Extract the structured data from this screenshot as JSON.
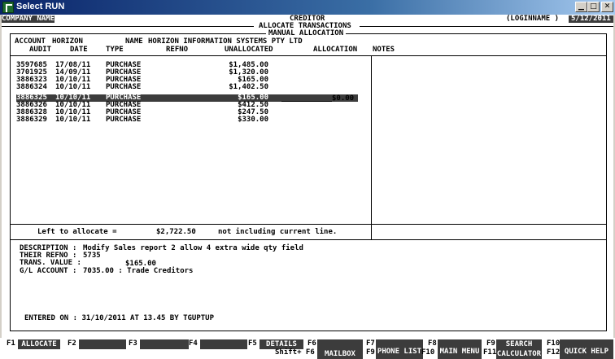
{
  "window": {
    "title": "Select RUN"
  },
  "header": {
    "company": "COMPANY NAME",
    "module": "CREDITOR",
    "login": "(LOGINNAME )",
    "date": "5/12/2011",
    "screen_title": "ALLOCATE TRANSACTIONS",
    "sub_title": "MANUAL ALLOCATION"
  },
  "account": {
    "account_label": "ACCOUNT",
    "account_code": "HORIZON",
    "name_label": "NAME",
    "name": "HORIZON INFORMATION SYSTEMS PTY LTD"
  },
  "columns": {
    "audit": "AUDIT",
    "date": "DATE",
    "type": "TYPE",
    "refno": "REFNO",
    "unallocated": "UNALLOCATED",
    "allocation": "ALLOCATION",
    "notes": "NOTES"
  },
  "rows": [
    {
      "audit": "3597685",
      "date": "17/08/11",
      "type": "PURCHASE",
      "unallocated": "$1,485.00"
    },
    {
      "audit": "3701925",
      "date": "14/09/11",
      "type": "PURCHASE",
      "unallocated": "$1,320.00"
    },
    {
      "audit": "3886323",
      "date": "10/10/11",
      "type": "PURCHASE",
      "unallocated": "$165.00"
    },
    {
      "audit": "3886324",
      "date": "10/10/11",
      "type": "PURCHASE",
      "unallocated": "$1,402.50"
    },
    {
      "audit": "3886325",
      "date": "10/10/11",
      "type": "PURCHASE",
      "unallocated": "$165.00"
    },
    {
      "audit": "3886326",
      "date": "10/10/11",
      "type": "PURCHASE",
      "unallocated": "$412.50"
    },
    {
      "audit": "3886328",
      "date": "10/10/11",
      "type": "PURCHASE",
      "unallocated": "$247.50"
    },
    {
      "audit": "3886329",
      "date": "10/10/11",
      "type": "PURCHASE",
      "unallocated": "$330.00"
    }
  ],
  "selected_allocation": "$0.00",
  "summary": {
    "left_label": "Left to allocate =",
    "left_value": "$2,722.50",
    "note": "not including current line."
  },
  "details": {
    "description_label": "DESCRIPTION :",
    "description": "Modify Sales report 2 allow 4 extra wide qty field",
    "refno_label": "THEIR REFNO :",
    "refno": "5735",
    "value_label": "TRANS. VALUE :",
    "value": "$165.00",
    "gl_label": "G/L ACCOUNT :",
    "gl": "7035.00 : Trade Creditors",
    "entered": "ENTERED ON : 31/10/2011 AT 13.45 BY TGUPTUP"
  },
  "fkeys": {
    "f1": "F1",
    "f1_label": "ALLOCATE",
    "f2": "F2",
    "f3": "F3",
    "f4": "F4",
    "f5": "F5",
    "f5_label": "DETAILS",
    "f6": "F6",
    "shift_f6": "Shift+ F6",
    "f6_label": "MAILBOX",
    "f7": "F7",
    "f9": "F9",
    "f7_label": "PHONE LIST",
    "f8": "F8",
    "f10": "F10",
    "f8_label": "MAIN MENU",
    "f9s": "F9",
    "f11": "F11",
    "f9_label": "SEARCH",
    "f11_label": "CALCULATOR",
    "f10s": "F10",
    "f12": "F12",
    "f12_label": "QUICK HELP"
  }
}
